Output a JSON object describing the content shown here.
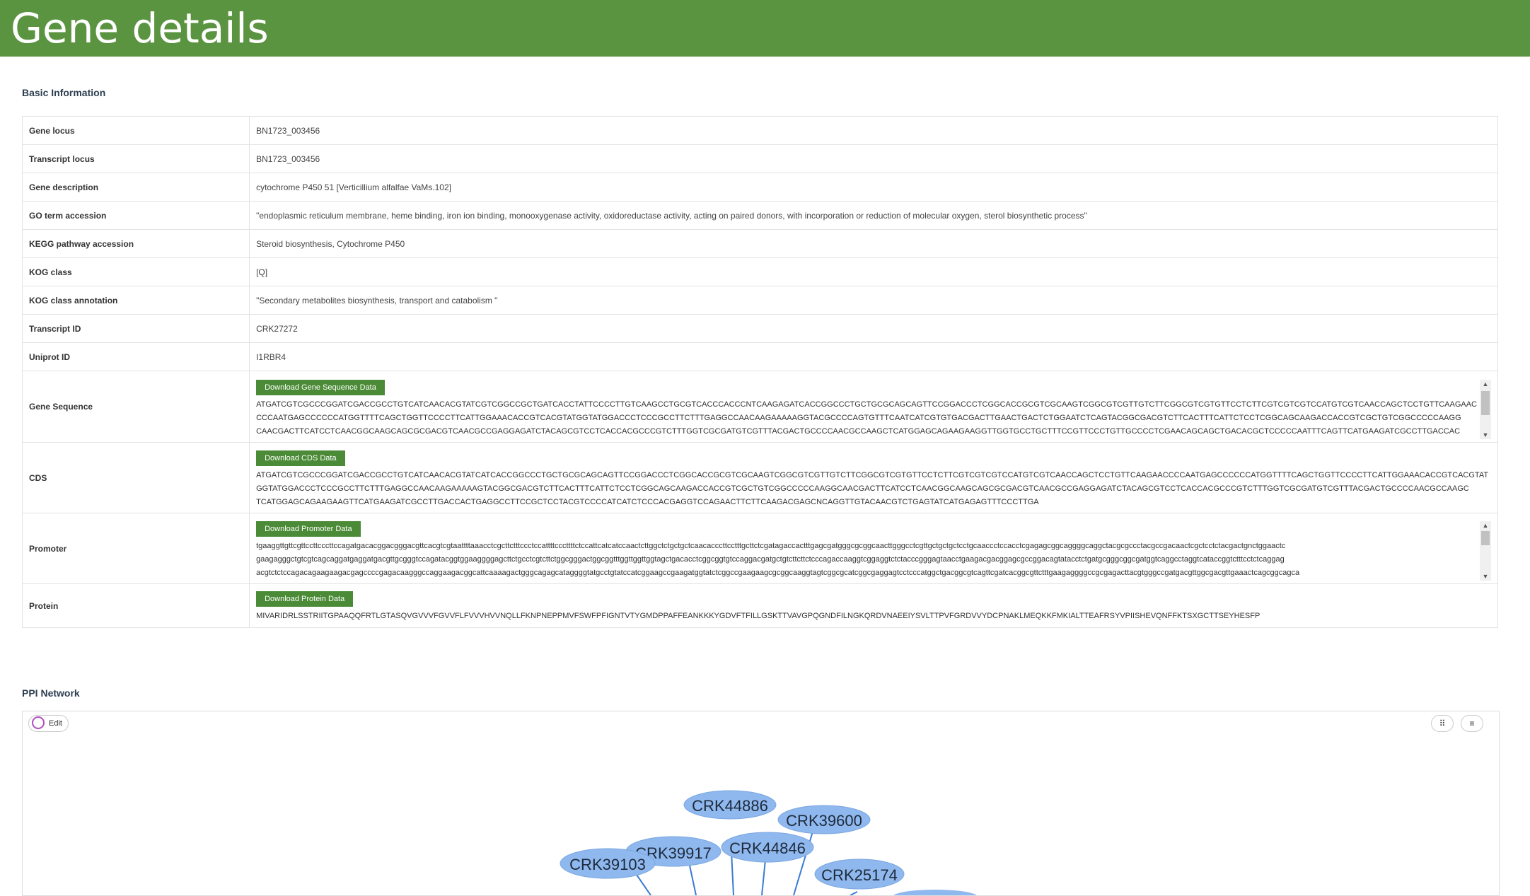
{
  "header": {
    "title": "Gene details"
  },
  "basic": {
    "title": "Basic Information",
    "rows": {
      "gene_locus": {
        "label": "Gene locus",
        "value": "BN1723_003456"
      },
      "transcript_locus": {
        "label": "Transcript locus",
        "value": "BN1723_003456"
      },
      "gene_description": {
        "label": "Gene description",
        "value": "cytochrome P450 51 [Verticillium alfalfae VaMs.102]"
      },
      "go_term": {
        "label": "GO term accession",
        "value": "\"endoplasmic reticulum membrane, heme binding, iron ion binding, monooxygenase activity, oxidoreductase activity, acting on paired donors, with incorporation or reduction of molecular oxygen, sterol biosynthetic process\""
      },
      "kegg": {
        "label": "KEGG pathway accession",
        "value": "Steroid biosynthesis, Cytochrome P450"
      },
      "kog_class": {
        "label": "KOG class",
        "value": "[Q]"
      },
      "kog_annotation": {
        "label": "KOG class annotation",
        "value": "\"Secondary metabolites biosynthesis, transport and catabolism \""
      },
      "transcript_id": {
        "label": "Transcript ID",
        "value": "CRK27272"
      },
      "uniprot_id": {
        "label": "Uniprot ID",
        "value": "I1RBR4"
      },
      "gene_sequence": {
        "label": "Gene Sequence",
        "button": "Download Gene Sequence Data",
        "lines": [
          "ATGATCGTCGCCCGGATCGACCGCCTGTCATCAACACGTATCGTCGGCCGCTGATCACCTATTCCCCTTGTCAAGCCTGCGTCACCCACCCNTCAAGAGATCACCGGCCCTGCTGCGCAGCAGTTCCGGACCCTCGGCACCGCGTCGCAAGTCGGCGTCGTTGTCTTCGGCGTCGTGTTCCTCTTCGTCGTCGTCCATGTCGTCAACCAGCTCCTGTTCAAGAAC",
          "CCCAATGAGCCCCCCATGGTTTTCAGCTGGTTCCCCTTCATTGGAAACACCGTCACGTATGGTATGGACCCTCCCGCCTTCTTTGAGGCCAACAAGAAAAAGGTACGCCCCAGTGTTTCAATCATCGTGTGACGACTTGAACTGACTCTGGAATCTCAGTACGGCGACGTCTTCACTTTCATTCTCCTCGGCAGCAAGACCACCGTCGCTGTCGGCCCCCAAGG",
          "CAACGACTTCATCCTCAACGGCAAGCAGCGCGACGTCAACGCCGAGGAGATCTACAGCGTCCTCACCACGCCCGTCTTTGGTCGCGATGTCGTTTACGACTGCCCCAACGCCAAGCTCATGGAGCAGAAGAAGGTTGGTGCCTGCTTTCCGTTCCCTGTTGCCCCTCGAACAGCAGCTGACACGCTCCCCCAATTTCAGTTCATGAAGATCGCCTTGACCAC"
        ]
      },
      "cds": {
        "label": "CDS",
        "button": "Download CDS Data",
        "lines": [
          "ATGATCGTCGCCCGGATCGACCGCCTGTCATCAACACGTATCATCACCGGCCCTGCTGCGCAGCAGTTCCGGACCCTCGGCACCGCGTCGCAAGTCGGCGTCGTTGTCTTCGGCGTCGTGTTCCTCTTCGTCGTCGTCCATGTCGTCAACCAGCTCCTGTTCAAGAACCCCAATGAGCCCCCCATGGTTTTCAGCTGGTTCCCCTTCATTGGAAACACCGTCACGTAT",
          "GGTATGGACCCTCCCGCCTTCTTTGAGGCCAACAAGAAAAAGTACGGCGACGTCTTCACTTTCATTCTCCTCGGCAGCAAGACCACCGTCGCTGTCGGCCCCCAAGGCAACGACTTCATCCTCAACGGCAAGCAGCGCGACGTCAACGCCGAGGAGATCTACAGCGTCCTCACCACGCCCGTCTTTGGTCGCGATGTCGTTTACGACTGCCCCAACGCCAAGC",
          "TCATGGAGCAGAAGAAGTTCATGAAGATCGCCTTGACCACTGAGGCCTTCCGCTCCTACGTCCCCATCATCTCCCACGAGGTCCAGAACTTCTTCAAGACGAGCNCAGGTTGTACAACGTCTGAGTATCATGAGAGTTTCCCTTGA"
        ]
      },
      "promoter": {
        "label": "Promoter",
        "button": "Download Promoter Data",
        "lines": [
          "tgaaggttgttcgttccttcccttccagatgacacggacgggacgttcacgtcgtaattttaaacctcgcttctttccctccattttcccttttctccattcatcatccaactcttggctctgctgctcaacacccttcctttgcttctcgatagaccactttgagcgatgggcgcggcaacttgggcctcgttgctgctgctcctgcaaccctccacctcgagagcggcaggggcaggctacgcgccctacgccgacaactcgctcctctacgactgnctggaactc",
          "gaagagggctgtcgtcagcaggatgaggatgacgttgcgggtccagatacggtggaaggggagcttctgcctcgtcttctggcgggactggcggtttggttggttggtagctgacacctcggcggtgtccaggacgatgctgtcttcttctcccagaccaaggtcggaggtctctacccgggagtaacctgaagacgacggagcgccggacagtatacctctgatgcgggcggcgatggtcaggcctaggtcataccggtctttcctctcaggag",
          "acgtctctccagacagaagaagacgagccccgagacaagggccaggaagacggcattcaaaagactgggcagagcataggggtatgcctgtatccatcggaagccgaagatggtatctcggccgaagaagcgcggcaaggtagtcggcgcatcggcgaggagtcctcccatggctgacggcgtcagttcgatcacggcgttctttgaagaggggccgcgagacttacgtgggccgatgacgttggcgacgttgaaactcagcggcagca"
        ]
      },
      "protein": {
        "label": "Protein",
        "button": "Download Protein Data",
        "value": "MIVARIDRLSSTRIITGPAAQQFRTLGTASQVGVVVFGVVFLFVVVHVVNQLLFKNPNEPPMVFSWFPFIGNTVTYGMDPPAFFEANKKKYGDVFTFILLGSKTTVAVGPQGNDFILNGKQRDVNAEEIYSVLTTPVFGRDVVYDCPNAKLMEQKKFMKIALTTEAFRSYVPIISHEVQNFFKTSXGCTTSEYHESFP"
      }
    }
  },
  "ppi": {
    "title": "PPI Network",
    "edit_label": "Edit",
    "grid_icon": "grid-icon",
    "menu_icon": "menu-icon",
    "node_color": "#8fb8ef",
    "edge_color": "#3a7bd5",
    "nodes": [
      "CRK44886",
      "CRK39600",
      "CRK39917",
      "CRK44846",
      "CRK39103",
      "CRK25174"
    ]
  }
}
